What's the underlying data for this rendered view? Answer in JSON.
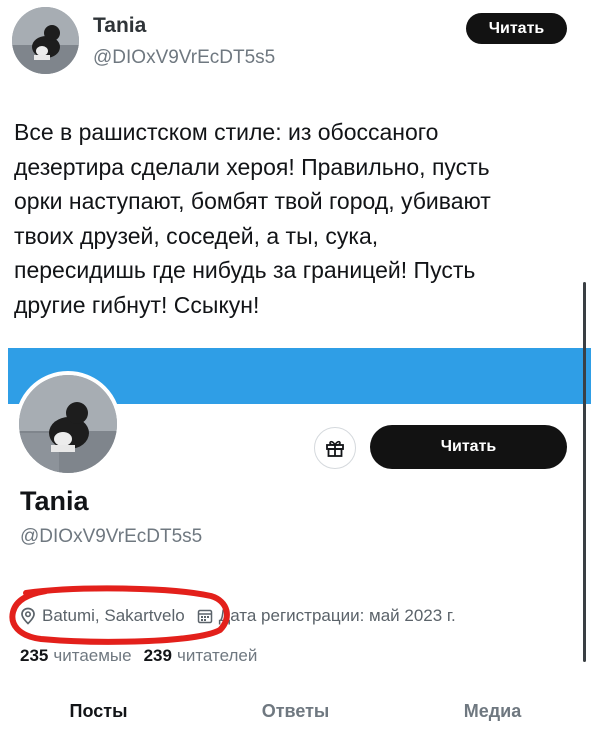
{
  "tweet": {
    "name": "Tania",
    "handle": "@DIOxV9VrEcDT5s5",
    "follow_label": "Читать",
    "text": "Все в рашистском стиле: из обоссаного\nдезертира сделали хероя! Правильно, пусть\nорки наступают, бомбят твой город, убивают\nтвоих друзей, соседей, а ты, сука,\nпересидишь где нибудь за границей! Пусть\nдругие гибнут! Ссыкун!"
  },
  "profile": {
    "name": "Tania",
    "handle": "@DIOxV9VrEcDT5s5",
    "follow_label": "Читать",
    "location": "Batumi, Sakartvelo",
    "joined": "Дата регистрации: май 2023 г.",
    "following_count": "235",
    "following_label": "читаемые",
    "followers_count": "239",
    "followers_label": "читателей"
  },
  "tabs": [
    {
      "label": "Посты",
      "active": true
    },
    {
      "label": "Ответы",
      "active": false
    },
    {
      "label": "Медиа",
      "active": false
    }
  ],
  "colors": {
    "banner": "#2f9ee6",
    "button": "#121212",
    "annotation": "#e3201b"
  },
  "icons": [
    "gift-icon",
    "location-pin-icon",
    "calendar-icon"
  ]
}
